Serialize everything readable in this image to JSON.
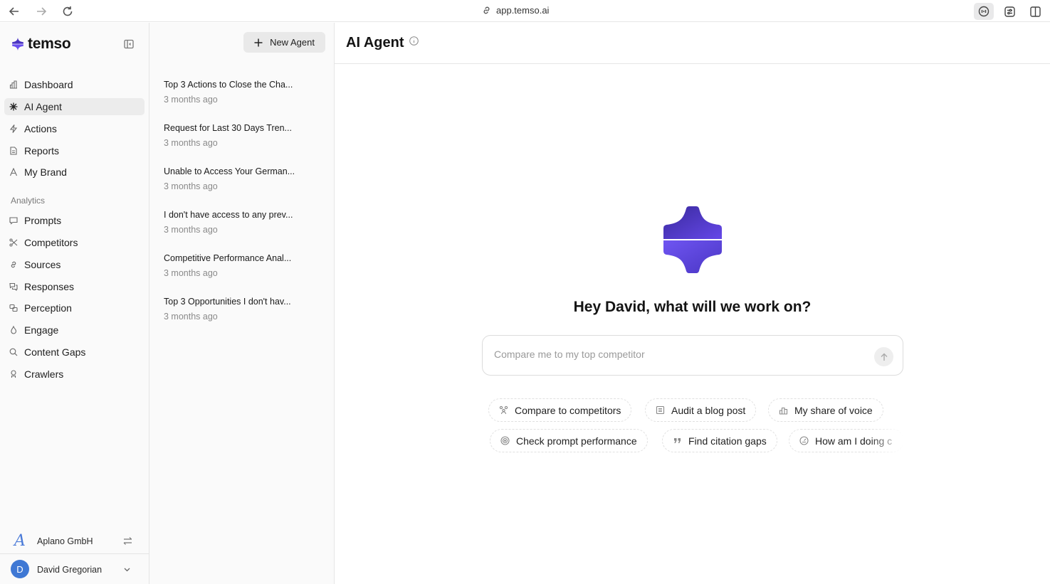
{
  "browser": {
    "url": "app.temso.ai"
  },
  "sidebar": {
    "brand": "temso",
    "nav_items": [
      {
        "label": "Dashboard",
        "icon": "bar-chart-icon"
      },
      {
        "label": "AI Agent",
        "icon": "sparkle-icon",
        "active": true
      },
      {
        "label": "Actions",
        "icon": "lightning-icon"
      },
      {
        "label": "Reports",
        "icon": "document-icon"
      },
      {
        "label": "My Brand",
        "icon": "letter-a-icon"
      }
    ],
    "analytics_label": "Analytics",
    "analytics_items": [
      {
        "label": "Prompts",
        "icon": "chat-bubble-icon"
      },
      {
        "label": "Competitors",
        "icon": "scissors-icon"
      },
      {
        "label": "Sources",
        "icon": "link-icon"
      },
      {
        "label": "Responses",
        "icon": "chat-bubbles-icon"
      },
      {
        "label": "Perception",
        "icon": "perception-icon"
      },
      {
        "label": "Engage",
        "icon": "flame-icon"
      },
      {
        "label": "Content Gaps",
        "icon": "magnifier-icon"
      },
      {
        "label": "Crawlers",
        "icon": "robot-icon"
      }
    ],
    "organization": "Aplano GmbH",
    "user": {
      "initial": "D",
      "name": "David Gregorian"
    }
  },
  "conversations": {
    "new_button": "New Agent",
    "items": [
      {
        "title": "Top 3 Actions to Close the Cha...",
        "time": "3 months ago"
      },
      {
        "title": "Request for Last 30 Days Tren...",
        "time": "3 months ago"
      },
      {
        "title": "Unable to Access Your German...",
        "time": "3 months ago"
      },
      {
        "title": "I don't have access to any prev...",
        "time": "3 months ago"
      },
      {
        "title": "Competitive Performance Anal...",
        "time": "3 months ago"
      },
      {
        "title": "Top 3 Opportunities I don't hav...",
        "time": "3 months ago"
      }
    ]
  },
  "main": {
    "title": "AI Agent",
    "greeting": "Hey David, what will we work on?",
    "input_placeholder": "Compare me to my top competitor",
    "suggestions": [
      {
        "label": "Compare to competitors",
        "icon": "people-icon"
      },
      {
        "label": "Audit a blog post",
        "icon": "document-lines-icon"
      },
      {
        "label": "My share of voice",
        "icon": "bar-chart-icon"
      },
      {
        "label": "Check prompt performance",
        "icon": "target-icon"
      },
      {
        "label": "Find citation gaps",
        "icon": "quote-icon"
      },
      {
        "label": "How am I doing c",
        "icon": "gauge-icon"
      }
    ]
  },
  "colors": {
    "brand_purple": "#5b3fd6",
    "avatar_blue": "#3f78d4"
  }
}
